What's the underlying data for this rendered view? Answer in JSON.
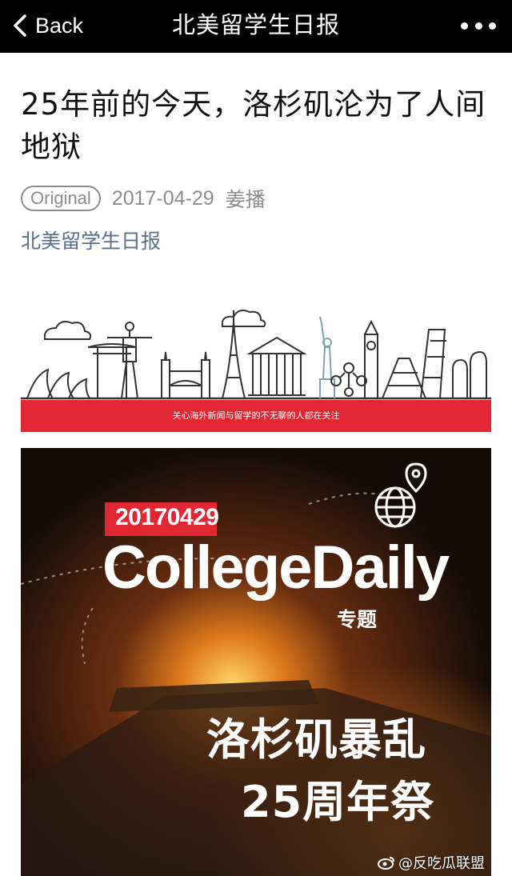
{
  "navbar": {
    "back_label": "Back",
    "title": "北美留学生日报",
    "more_icon": "more-dots-icon"
  },
  "article": {
    "title": "25年前的今天，洛杉矶沦为了人间地狱",
    "badge": "Original",
    "date": "2017-04-29",
    "author": "姜播",
    "account": "北美留学生日报"
  },
  "banner": {
    "strip_text": "关心海外新闻与留学的不无聊的人都在关注",
    "strip_color": "#e02733"
  },
  "cover": {
    "date_tag": "20170429",
    "brand": "CollegeDaily",
    "special_label": "专题",
    "headline_line1": "洛杉矶暴乱",
    "headline_line2": "25周年祭",
    "accent_color": "#e02733"
  },
  "watermark": {
    "text": "@反吃瓜联盟"
  }
}
